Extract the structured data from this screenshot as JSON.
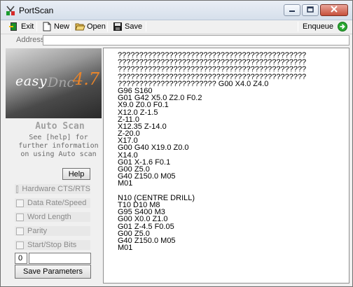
{
  "window": {
    "title": "PortScan",
    "app_icon": "portscan-app-icon",
    "buttons": [
      "minimize-icon",
      "maximize-icon",
      "close-icon"
    ]
  },
  "toolbar": {
    "exit_label": "Exit",
    "new_label": "New",
    "open_label": "Open",
    "save_label": "Save",
    "enqueue_label": "Enqueue",
    "icons": {
      "exit": "exit-icon",
      "new": "new-document-icon",
      "open": "open-folder-icon",
      "save": "floppy-disk-icon",
      "enqueue": "green-arrow-icon"
    }
  },
  "address": {
    "label": "Address",
    "value": ""
  },
  "logo": {
    "easy": "easy",
    "dnc": "Dnc",
    "version": "4.7"
  },
  "autoscan": {
    "title": "Auto Scan",
    "help_text": [
      "See [help] for",
      "further information",
      "on using Auto scan"
    ],
    "help_button": "Help"
  },
  "options": [
    {
      "label": "Hardware CTS/RTS",
      "checked": false
    },
    {
      "label": "Data Rate/Speed",
      "checked": false
    },
    {
      "label": "Word Length",
      "checked": false
    },
    {
      "label": "Parity",
      "checked": false
    },
    {
      "label": "Start/Stop Bits",
      "checked": false
    }
  ],
  "parameters": {
    "number_value": "0",
    "text_value": "",
    "save_button": "Save Parameters"
  },
  "editor": {
    "lines": [
      "????????????????????????????????????????????",
      "????????????????????????????????????????????",
      "????????????????????????????????????????????",
      "????????????????????????????????????????????",
      "??????????????????????? G00 X4.0 Z4.0",
      "G96 S160",
      "G01 G42 X5.0 Z2.0 F0.2",
      "X9.0 Z0.0 F0.1",
      "X12.0 Z-1.5",
      "Z-11.0",
      "X12.35 Z-14.0",
      "Z-20.0",
      "X17.0",
      "G00 G40 X19.0 Z0.0",
      "X14.0",
      "G01 X-1.6 F0.1",
      "G00 Z5.0",
      "G40 Z150.0 M05",
      "M01",
      "",
      "N10 (CENTRE DRILL)",
      "T10 D10 M8",
      "G95 S400 M3",
      "G00 X0.0 Z1.0",
      "G01 Z-4.5 F0.05",
      "G00 Z5.0",
      "G40 Z150.0 M05",
      "M01"
    ]
  },
  "colors": {
    "version_accent": "#e8842a",
    "close_button": "#c7503b",
    "enqueue_arrow": "#2aa830"
  }
}
